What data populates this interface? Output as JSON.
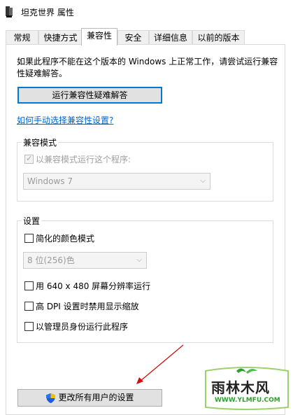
{
  "window": {
    "title": "坦克世界 属性"
  },
  "tabs": [
    {
      "label": "常规"
    },
    {
      "label": "快捷方式"
    },
    {
      "label": "兼容性"
    },
    {
      "label": "安全"
    },
    {
      "label": "详细信息"
    },
    {
      "label": "以前的版本"
    }
  ],
  "compat": {
    "description": "如果此程序不能在这个版本的 Windows 上正常工作，请尝试运行兼容性疑难解答。",
    "troubleshoot_button": "运行兼容性疑难解答",
    "manual_link": "如何手动选择兼容性设置?"
  },
  "compat_mode": {
    "group_title": "兼容模式",
    "checkbox_label": "以兼容模式运行这个程序:",
    "checked": true,
    "selected_os": "Windows 7"
  },
  "settings": {
    "group_title": "设置",
    "reduced_color_label": "简化的颜色模式",
    "color_select_value": "8 位(256)色",
    "res_640_label": "用 640 x 480 屏幕分辨率运行",
    "high_dpi_label": "高 DPI 设置时禁用显示缩放",
    "run_as_admin_label": "以管理员身份运行此程序"
  },
  "bottom": {
    "all_users_button": "更改所有用户的设置"
  },
  "watermark": {
    "brand": "雨林木风",
    "url": "WWW.YLMFU.COM"
  },
  "colors": {
    "focus_blue": "#0078d7",
    "link_blue": "#0066cc",
    "arrow_red": "#d01010"
  }
}
